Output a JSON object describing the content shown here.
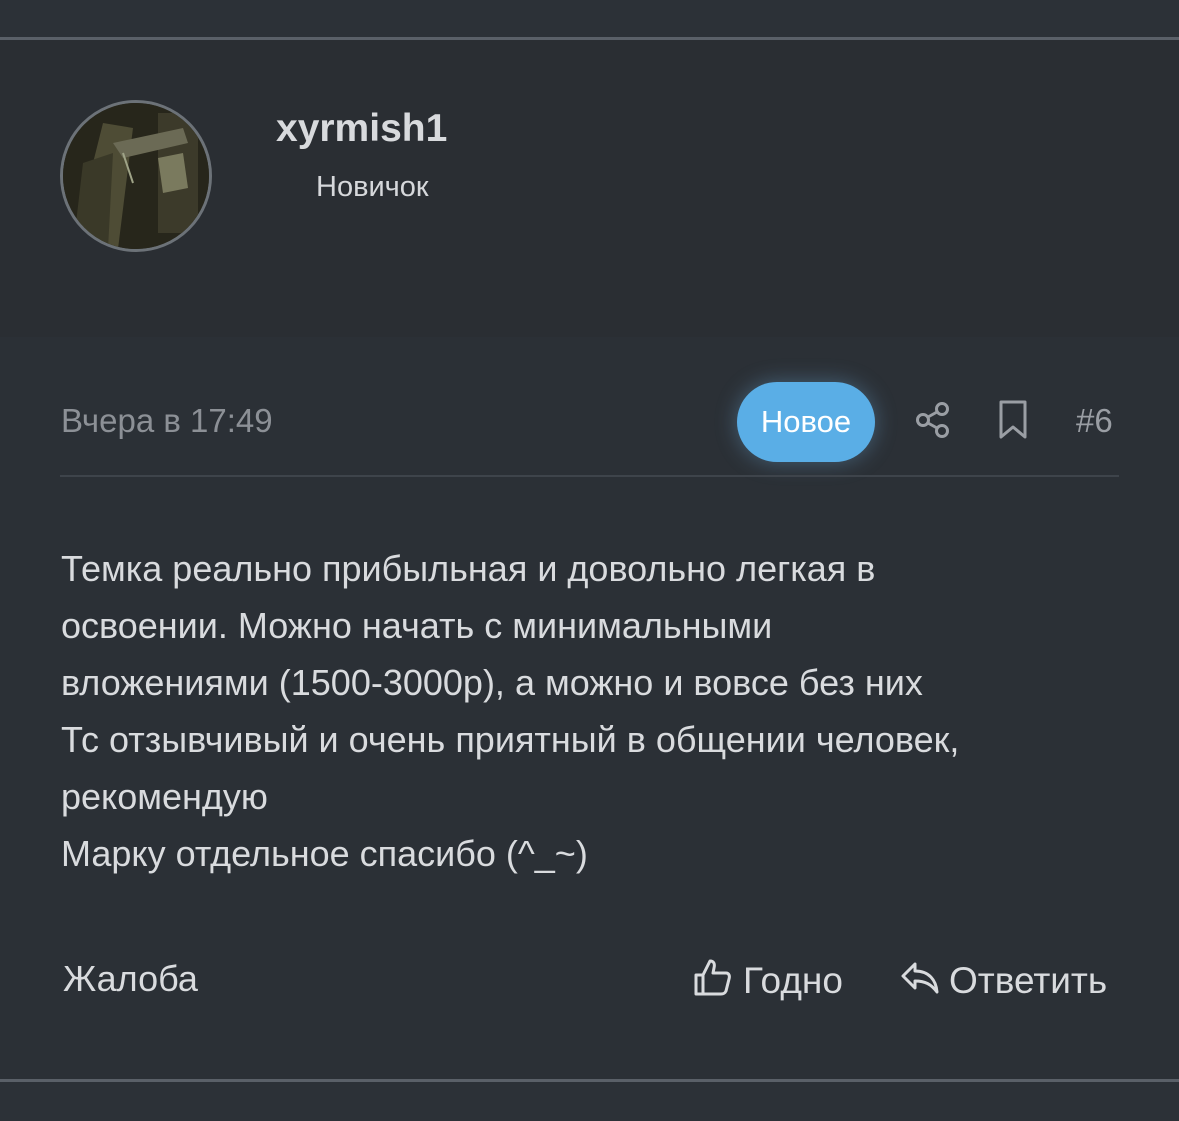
{
  "user": {
    "name": "xyrmish1",
    "rank": "Новичок"
  },
  "post": {
    "date": "Вчера в 17:49",
    "badge": "Новое",
    "number": "#6",
    "message_lines": [
      "Темка реально прибыльная и довольно легкая в",
      "освоении. Можно начать с минимальными",
      "вложениями (1500-3000р), а можно и вовсе без них",
      "Тс отзывчивый и очень приятный в общении человек,",
      "рекомендую",
      "Марку отдельное спасибо (^_~)"
    ]
  },
  "actions": {
    "report": "Жалоба",
    "like": "Годно",
    "reply": "Ответить"
  },
  "icons": {
    "share": "share-icon",
    "bookmark": "bookmark-icon",
    "like": "thumbs-up-icon",
    "reply": "reply-arrow-icon"
  },
  "colors": {
    "background": "#2b3036",
    "badge": "#5aaee6",
    "text": "#d9dbde",
    "muted": "#8c9096"
  }
}
